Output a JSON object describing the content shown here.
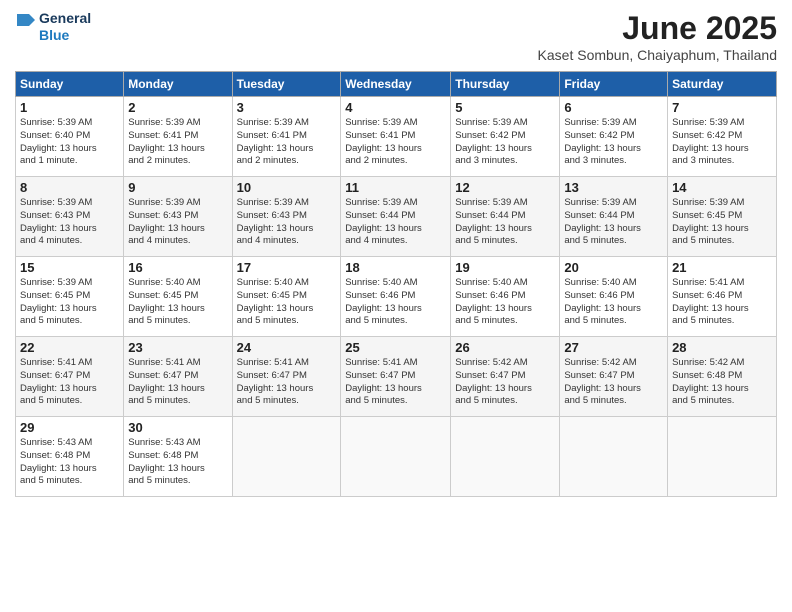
{
  "header": {
    "logo_line1": "General",
    "logo_line2": "Blue",
    "title": "June 2025",
    "subtitle": "Kaset Sombun, Chaiyaphum, Thailand"
  },
  "days_of_week": [
    "Sunday",
    "Monday",
    "Tuesday",
    "Wednesday",
    "Thursday",
    "Friday",
    "Saturday"
  ],
  "weeks": [
    [
      {
        "day": "1",
        "info": "Sunrise: 5:39 AM\nSunset: 6:40 PM\nDaylight: 13 hours\nand 1 minute."
      },
      {
        "day": "2",
        "info": "Sunrise: 5:39 AM\nSunset: 6:41 PM\nDaylight: 13 hours\nand 2 minutes."
      },
      {
        "day": "3",
        "info": "Sunrise: 5:39 AM\nSunset: 6:41 PM\nDaylight: 13 hours\nand 2 minutes."
      },
      {
        "day": "4",
        "info": "Sunrise: 5:39 AM\nSunset: 6:41 PM\nDaylight: 13 hours\nand 2 minutes."
      },
      {
        "day": "5",
        "info": "Sunrise: 5:39 AM\nSunset: 6:42 PM\nDaylight: 13 hours\nand 3 minutes."
      },
      {
        "day": "6",
        "info": "Sunrise: 5:39 AM\nSunset: 6:42 PM\nDaylight: 13 hours\nand 3 minutes."
      },
      {
        "day": "7",
        "info": "Sunrise: 5:39 AM\nSunset: 6:42 PM\nDaylight: 13 hours\nand 3 minutes."
      }
    ],
    [
      {
        "day": "8",
        "info": "Sunrise: 5:39 AM\nSunset: 6:43 PM\nDaylight: 13 hours\nand 4 minutes."
      },
      {
        "day": "9",
        "info": "Sunrise: 5:39 AM\nSunset: 6:43 PM\nDaylight: 13 hours\nand 4 minutes."
      },
      {
        "day": "10",
        "info": "Sunrise: 5:39 AM\nSunset: 6:43 PM\nDaylight: 13 hours\nand 4 minutes."
      },
      {
        "day": "11",
        "info": "Sunrise: 5:39 AM\nSunset: 6:44 PM\nDaylight: 13 hours\nand 4 minutes."
      },
      {
        "day": "12",
        "info": "Sunrise: 5:39 AM\nSunset: 6:44 PM\nDaylight: 13 hours\nand 5 minutes."
      },
      {
        "day": "13",
        "info": "Sunrise: 5:39 AM\nSunset: 6:44 PM\nDaylight: 13 hours\nand 5 minutes."
      },
      {
        "day": "14",
        "info": "Sunrise: 5:39 AM\nSunset: 6:45 PM\nDaylight: 13 hours\nand 5 minutes."
      }
    ],
    [
      {
        "day": "15",
        "info": "Sunrise: 5:39 AM\nSunset: 6:45 PM\nDaylight: 13 hours\nand 5 minutes."
      },
      {
        "day": "16",
        "info": "Sunrise: 5:40 AM\nSunset: 6:45 PM\nDaylight: 13 hours\nand 5 minutes."
      },
      {
        "day": "17",
        "info": "Sunrise: 5:40 AM\nSunset: 6:45 PM\nDaylight: 13 hours\nand 5 minutes."
      },
      {
        "day": "18",
        "info": "Sunrise: 5:40 AM\nSunset: 6:46 PM\nDaylight: 13 hours\nand 5 minutes."
      },
      {
        "day": "19",
        "info": "Sunrise: 5:40 AM\nSunset: 6:46 PM\nDaylight: 13 hours\nand 5 minutes."
      },
      {
        "day": "20",
        "info": "Sunrise: 5:40 AM\nSunset: 6:46 PM\nDaylight: 13 hours\nand 5 minutes."
      },
      {
        "day": "21",
        "info": "Sunrise: 5:41 AM\nSunset: 6:46 PM\nDaylight: 13 hours\nand 5 minutes."
      }
    ],
    [
      {
        "day": "22",
        "info": "Sunrise: 5:41 AM\nSunset: 6:47 PM\nDaylight: 13 hours\nand 5 minutes."
      },
      {
        "day": "23",
        "info": "Sunrise: 5:41 AM\nSunset: 6:47 PM\nDaylight: 13 hours\nand 5 minutes."
      },
      {
        "day": "24",
        "info": "Sunrise: 5:41 AM\nSunset: 6:47 PM\nDaylight: 13 hours\nand 5 minutes."
      },
      {
        "day": "25",
        "info": "Sunrise: 5:41 AM\nSunset: 6:47 PM\nDaylight: 13 hours\nand 5 minutes."
      },
      {
        "day": "26",
        "info": "Sunrise: 5:42 AM\nSunset: 6:47 PM\nDaylight: 13 hours\nand 5 minutes."
      },
      {
        "day": "27",
        "info": "Sunrise: 5:42 AM\nSunset: 6:47 PM\nDaylight: 13 hours\nand 5 minutes."
      },
      {
        "day": "28",
        "info": "Sunrise: 5:42 AM\nSunset: 6:48 PM\nDaylight: 13 hours\nand 5 minutes."
      }
    ],
    [
      {
        "day": "29",
        "info": "Sunrise: 5:43 AM\nSunset: 6:48 PM\nDaylight: 13 hours\nand 5 minutes."
      },
      {
        "day": "30",
        "info": "Sunrise: 5:43 AM\nSunset: 6:48 PM\nDaylight: 13 hours\nand 5 minutes."
      },
      {
        "day": "",
        "info": ""
      },
      {
        "day": "",
        "info": ""
      },
      {
        "day": "",
        "info": ""
      },
      {
        "day": "",
        "info": ""
      },
      {
        "day": "",
        "info": ""
      }
    ]
  ]
}
